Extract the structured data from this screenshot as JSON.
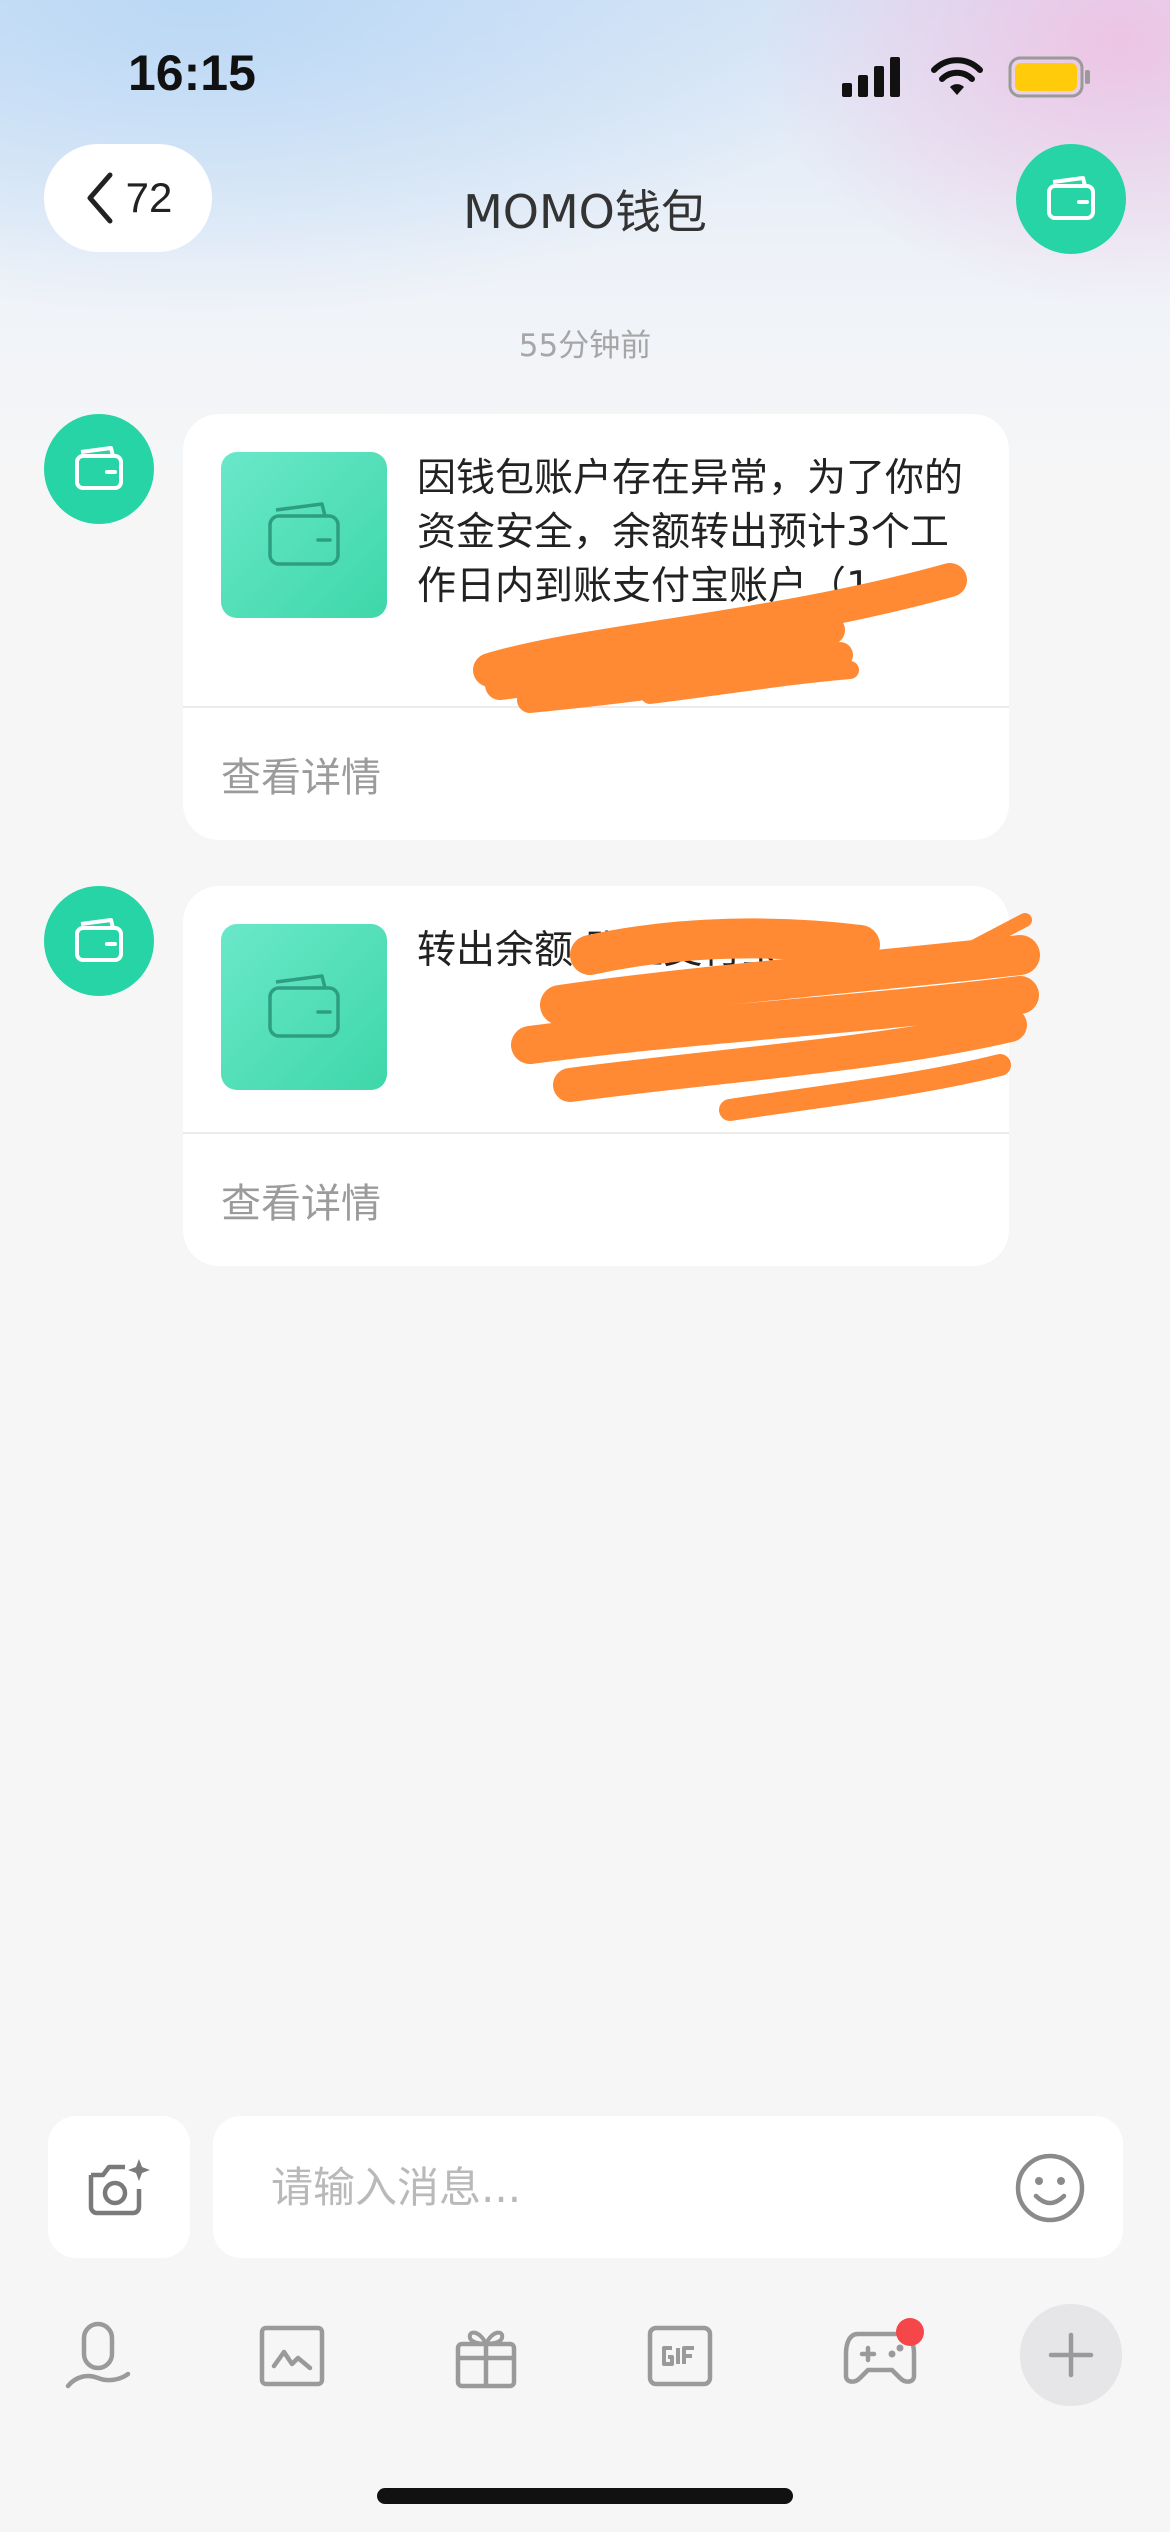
{
  "status_bar": {
    "time": "16:15"
  },
  "nav": {
    "back_count": "72",
    "title": "MOMO钱包"
  },
  "chat": {
    "timestamp": "55分钟前",
    "messages": [
      {
        "text": "因钱包账户存在异常，为了你的资金安全，余额转出预计3个工作日内到账支付宝账户（1",
        "footer": "查看详情"
      },
      {
        "text": "转出余额 账至支付宝",
        "footer": "查看详情"
      }
    ]
  },
  "input": {
    "placeholder": "请输入消息..."
  },
  "colors": {
    "brand": "#26d4a5",
    "badge": "#f5474a",
    "redaction": "#ff8a33"
  },
  "toolbar_icons": [
    "mic-icon",
    "doodle-icon",
    "gift-icon",
    "gif-icon",
    "game-controller-icon",
    "plus-icon"
  ]
}
